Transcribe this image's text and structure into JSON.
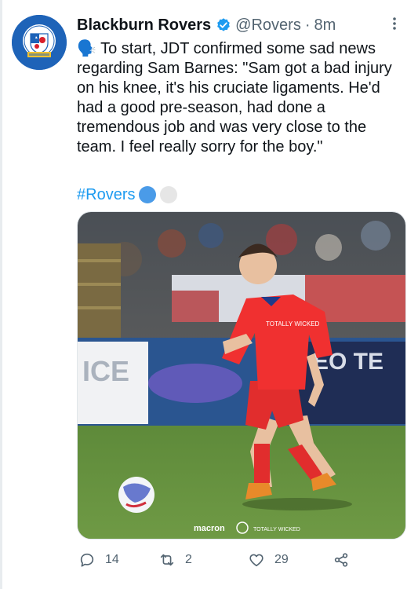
{
  "tweet": {
    "author_name": "Blackburn Rovers",
    "handle": "@Rovers",
    "separator": "·",
    "time": "8m",
    "avatar_icon": "blackburn-rovers-crest",
    "text": "🗣️ To start, JDT confirmed some sad news regarding Sam Barnes: \"Sam got a bad injury on his knee, it's his cruciate ligaments. He'd had a good pre-season, had done a tremendous job and was very close to the team. I feel really sorry for the boy.\"",
    "hashtag": "#Rovers",
    "hashtag_emoji_colors": [
      "#4a9be8",
      "#e6e6e6"
    ],
    "image": {
      "description": "player in red kit dribbling a football on grass",
      "sponsor_text": "macron",
      "partner_text": "TOTALLY WICKED",
      "banner_text_left": "ICE",
      "banner_text_right": "EO TE"
    },
    "actions": {
      "reply_count": "14",
      "retweet_count": "2",
      "like_count": "29"
    }
  },
  "colors": {
    "text": "#0f1419",
    "secondary": "#536471",
    "link": "#1d9bf0",
    "verified": "#1d9bf0"
  }
}
